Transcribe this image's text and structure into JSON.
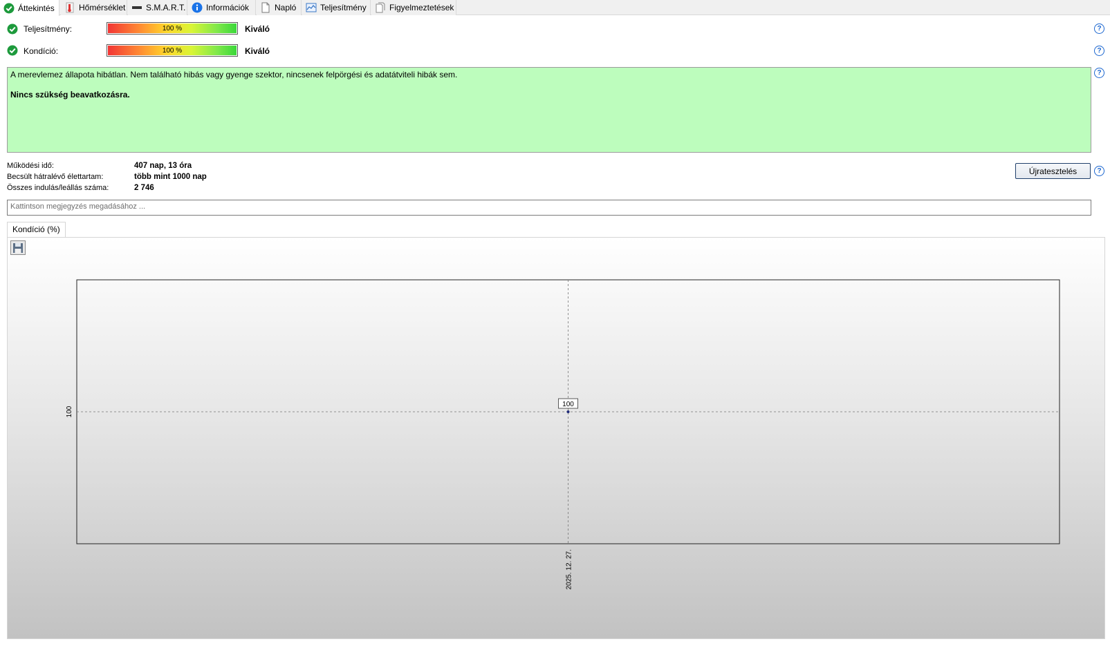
{
  "tabs": [
    {
      "label": "Áttekintés",
      "icon": "check-circle-icon",
      "active": true
    },
    {
      "label": "Hőmérséklet",
      "icon": "thermometer-icon"
    },
    {
      "label": "S.M.A.R.T.",
      "icon": "drive-icon"
    },
    {
      "label": "Információk",
      "icon": "info-icon"
    },
    {
      "label": "Napló",
      "icon": "document-icon"
    },
    {
      "label": "Teljesítmény",
      "icon": "performance-chart-icon"
    },
    {
      "label": "Figyelmeztetések",
      "icon": "alerts-document-icon"
    }
  ],
  "ratings": {
    "performance": {
      "label": "Teljesítmény:",
      "percent_text": "100 %",
      "level": 1.0,
      "rating": "Kiváló"
    },
    "condition": {
      "label": "Kondíció:",
      "percent_text": "100 %",
      "level": 1.0,
      "rating": "Kiváló"
    }
  },
  "status": {
    "line1": "A merevlemez állapota hibátlan. Nem található hibás vagy gyenge szektor, nincsenek felpörgési és adatátviteli hibák sem.",
    "line2": "Nincs szükség beavatkozásra.",
    "background": "#bdfdbd"
  },
  "info": {
    "uptime_label": "Működési idő:",
    "uptime_value": "407 nap, 13 óra",
    "lifetime_label": "Becsült hátralévő élettartam:",
    "lifetime_value": "több mint 1000 nap",
    "startstop_label": "Összes indulás/leállás száma:",
    "startstop_value": "2 746"
  },
  "retest_button": "Újratesztelés",
  "note_placeholder": "Kattintson megjegyzés megadásához ...",
  "chart_tab": "Kondíció  (%)",
  "chart_data": {
    "type": "line",
    "title": "",
    "xlabel": "",
    "ylabel": "",
    "x": [
      "2025. 12. 27."
    ],
    "y": [
      100
    ],
    "tick_labels": {
      "y": [
        "100"
      ],
      "x": [
        "2025. 12. 27."
      ]
    },
    "data_labels": [
      "100"
    ],
    "grid": true
  }
}
